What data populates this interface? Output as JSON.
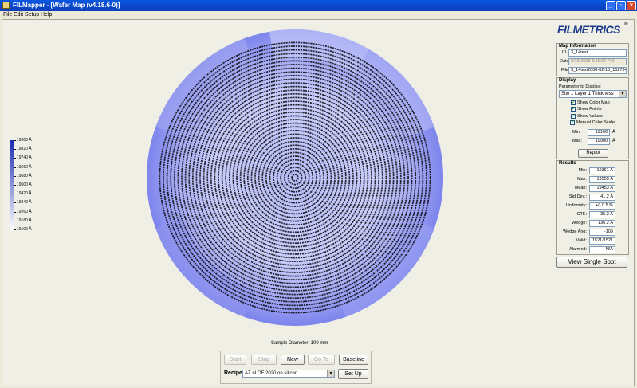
{
  "window": {
    "title": "FILMapper - [Wafer Map (v4.18.6-0)]"
  },
  "menu": [
    "File",
    "Edit",
    "Setup",
    "Help"
  ],
  "legend": {
    "labels": [
      "19900 Å",
      "19820 Å",
      "19740 Å",
      "19660 Å",
      "19580 Å",
      "19500 Å",
      "19420 Å",
      "19340 Å",
      "19260 Å",
      "19180 Å",
      "19100 Å"
    ],
    "color_dark": "#1a2bb0",
    "color_light": "#ffffff"
  },
  "wafer": {
    "sample_diameter": "Sample Diameter: 100 mm",
    "ring_color_outer": "#a9aef4",
    "ring_color_inner": "#c9cdfa",
    "center_color": "#b7bcf6",
    "edge_color": "#7d84ec",
    "value_color": "#000000"
  },
  "controls": {
    "start": "Start",
    "stop": "Stop",
    "new": "New",
    "goto": "Go To",
    "baseline": "Baseline",
    "recipe_label": "Recipe:",
    "recipe_value": "AZ nLOF 2020 on silicon",
    "setup": "Set Up"
  },
  "logo": {
    "text": "FILMETRICS",
    "color": "#1b3a8a"
  },
  "map_info": {
    "title": "Map Information",
    "id_label": "ID",
    "id_value": "3_14test",
    "date_label": "Date",
    "date_value": "2/15/2008 3:19:07 PM",
    "file_label": "File",
    "file_value": "3_14test2008-02-15_152734.r"
  },
  "display": {
    "title": "Display",
    "param_label": "Parameter to Display:",
    "param_value": "Site 1 Layer 1 Thickness",
    "show_color_map": "Show Color Map",
    "show_points": "Show Points",
    "show_values": "Show Values",
    "manual_color_scale": "Manual Color Scale",
    "min_label": "Min:",
    "min_value": "19100",
    "min_unit": "Å",
    "max_label": "Max:",
    "max_value": "19900",
    "max_unit": "Å",
    "replot": "Replot"
  },
  "results": {
    "title": "Results",
    "rows": [
      {
        "label": "Min:",
        "value": "19361 Å"
      },
      {
        "label": "Max:",
        "value": "19555 Å"
      },
      {
        "label": "Mean:",
        "value": "19453 Å"
      },
      {
        "label": "Std.Dev.:",
        "value": "41.2 Å"
      },
      {
        "label": "Uniformity:",
        "value": "+/- 0.5 %"
      },
      {
        "label": "CTE:",
        "value": "-35.2 Å"
      },
      {
        "label": "Wedge:",
        "value": "136.2 Å"
      },
      {
        "label": "Wedge Ang:",
        "value": "-109"
      },
      {
        "label": "Valid:",
        "value": "1521/1521"
      },
      {
        "label": "Alarmed:",
        "value": "N/A"
      }
    ]
  },
  "view_single_spot": "View Single Spot"
}
